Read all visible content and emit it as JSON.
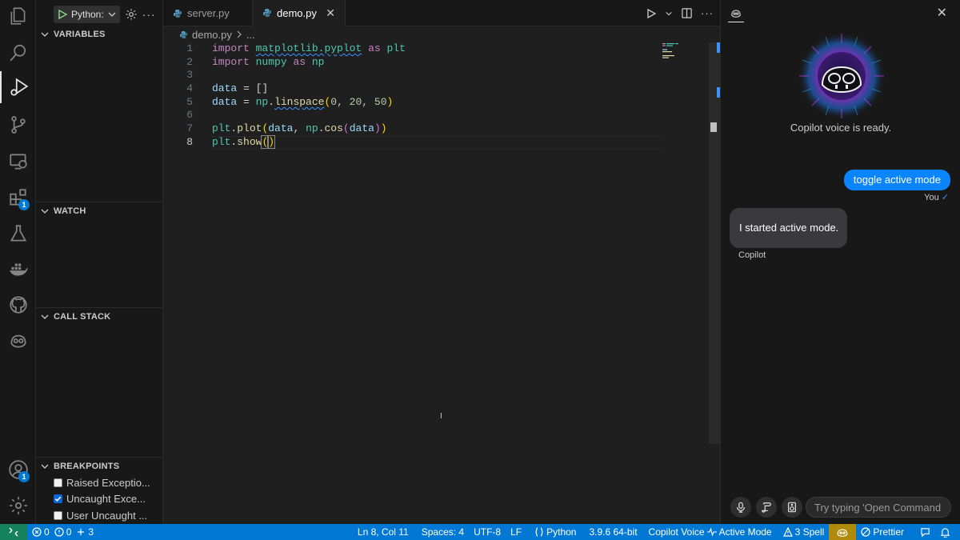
{
  "activity_bar": {
    "extensions_badge": "1",
    "accounts_badge": "1"
  },
  "debug": {
    "run_config": "Python:",
    "sections": {
      "variables": "VARIABLES",
      "watch": "WATCH",
      "call_stack": "CALL STACK",
      "breakpoints": "BREAKPOINTS"
    },
    "breakpoints": [
      {
        "label": "Raised Exceptio...",
        "checked": false
      },
      {
        "label": "Uncaught Exce...",
        "checked": true
      },
      {
        "label": "User Uncaught ...",
        "checked": false
      }
    ]
  },
  "editor": {
    "tabs": [
      {
        "label": "server.py",
        "active": false
      },
      {
        "label": "demo.py",
        "active": true
      }
    ],
    "breadcrumb": {
      "file": "demo.py",
      "rest": "..."
    },
    "line_numbers": [
      "1",
      "2",
      "3",
      "4",
      "5",
      "6",
      "7",
      "8"
    ],
    "code": {
      "l1": {
        "import": "import",
        "module": "matplotlib.pyplot",
        "as": "as",
        "alias": "plt"
      },
      "l2": {
        "import": "import",
        "module": "numpy",
        "as": "as",
        "alias": "np"
      },
      "l4": {
        "var": "data",
        "rest": " = []"
      },
      "l5": {
        "var": "data",
        "eq": " = ",
        "np": "np",
        "dot": ".",
        "fn": "linspace",
        "args": "0, 20, 50"
      },
      "l7": {
        "obj": "plt",
        "fn": "plot",
        "arg1": "data",
        "np": "np",
        "fn2": "cos",
        "arg2": "data"
      },
      "l8": {
        "obj": "plt",
        "fn": "show"
      }
    },
    "current_line": 8
  },
  "copilot": {
    "ready_text": "Copilot voice is ready.",
    "messages": [
      {
        "from": "user",
        "text": "toggle active mode",
        "name": "You",
        "check": "✓"
      },
      {
        "from": "bot",
        "text": "I started active mode.",
        "name": "Copilot"
      }
    ],
    "input_placeholder": "Try typing 'Open Command P"
  },
  "status_bar": {
    "errors": "0",
    "warnings": "0",
    "ports": "3",
    "position": "Ln 8, Col 11",
    "spaces": "Spaces: 4",
    "encoding": "UTF-8",
    "eol": "LF",
    "language": "Python",
    "interpreter": "3.9.6 64-bit",
    "copilot_voice": "Copilot Voice",
    "active_mode": "Active Mode",
    "spell": "3 Spell",
    "prettier": "Prettier"
  },
  "colors": {
    "accent": "#0078d4",
    "user_bubble": "#0a84ff",
    "bot_bubble": "#3a3a3c",
    "remote": "#16825d"
  }
}
